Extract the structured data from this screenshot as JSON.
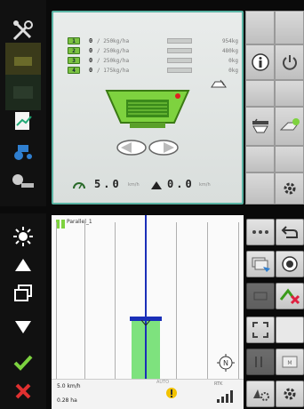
{
  "spreader": {
    "sections": [
      {
        "num": "1",
        "rate": "0",
        "target": "/ 250kg/ha",
        "kg": "954kg"
      },
      {
        "num": "2",
        "rate": "0",
        "target": "/ 250kg/ha",
        "kg": "480kg"
      },
      {
        "num": "3",
        "rate": "0",
        "target": "/ 250kg/ha",
        "kg": "0kg"
      },
      {
        "num": "4",
        "rate": "0",
        "target": "/ 175kg/ha",
        "kg": "0kg"
      }
    ],
    "speed_value": "5.0",
    "speed_unit": "km/h",
    "rate_value": "0.0",
    "rate_unit": "km/h"
  },
  "field": {
    "track_name": "Parallel_1",
    "speed": "5.0 km/h",
    "area": "0.28 ha",
    "gps_label": "AUTO",
    "rtk_label": "RTK"
  },
  "colors": {
    "accent": "#5ab4a4",
    "implement_green": "#7ed23f",
    "track_blue": "#1a2fb8",
    "coverage_green": "#7ee27e"
  }
}
